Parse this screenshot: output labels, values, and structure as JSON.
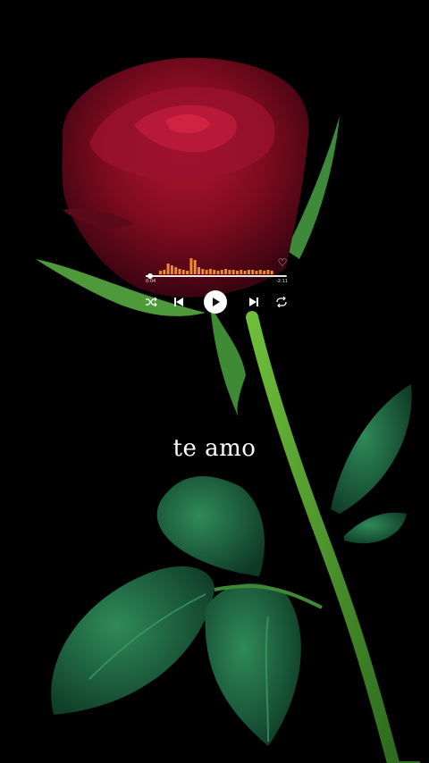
{
  "player": {
    "elapsed": "0:04",
    "remaining": "-2:11",
    "progress": 0.03,
    "accent_color": "#f08a2a",
    "icons": [
      "heart-icon",
      "shuffle-icon",
      "previous-icon",
      "play-icon",
      "next-icon",
      "repeat-icon"
    ]
  },
  "caption": "te amo"
}
